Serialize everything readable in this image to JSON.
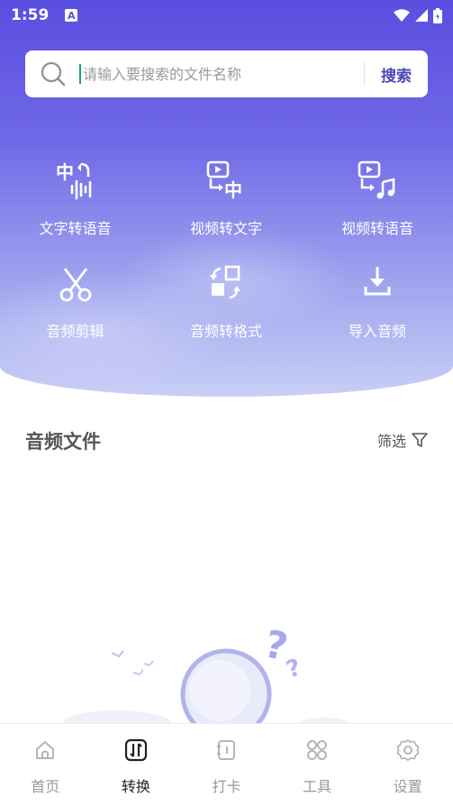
{
  "status_bar": {
    "time": "1:59",
    "notification_badge": "A"
  },
  "search": {
    "placeholder": "请输入要搜索的文件名称",
    "button_label": "搜索"
  },
  "features": [
    {
      "label": "文字转语音",
      "icon": "text-to-speech-icon"
    },
    {
      "label": "视频转文字",
      "icon": "video-to-text-icon"
    },
    {
      "label": "视频转语音",
      "icon": "video-to-audio-icon"
    },
    {
      "label": "音频剪辑",
      "icon": "scissors-icon"
    },
    {
      "label": "音频转格式",
      "icon": "format-convert-icon"
    },
    {
      "label": "导入音频",
      "icon": "import-download-icon"
    }
  ],
  "section": {
    "title": "音频文件",
    "filter_label": "筛选"
  },
  "tabbar": {
    "tabs": [
      {
        "label": "首页",
        "icon": "home-icon",
        "active": false
      },
      {
        "label": "转换",
        "icon": "convert-icon",
        "active": true
      },
      {
        "label": "打卡",
        "icon": "notebook-icon",
        "active": false
      },
      {
        "label": "工具",
        "icon": "grid-tools-icon",
        "active": false
      },
      {
        "label": "设置",
        "icon": "gear-icon",
        "active": false
      }
    ]
  },
  "colors": {
    "accent": "#4a47b8",
    "hero_top": "#5a4ee0",
    "hero_bottom": "#c9cff6"
  }
}
